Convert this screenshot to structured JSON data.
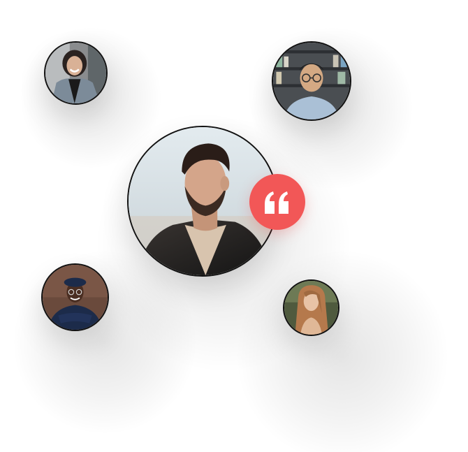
{
  "colors": {
    "accent": "#f25757",
    "border": "#111111",
    "background": "#ffffff"
  },
  "badge": {
    "icon": "quote-icon"
  },
  "avatars": [
    {
      "name": "featured-avatar",
      "description": "man with beard"
    },
    {
      "name": "avatar-woman-denim"
    },
    {
      "name": "avatar-man-glasses"
    },
    {
      "name": "avatar-man-beret"
    },
    {
      "name": "avatar-woman-long-hair"
    }
  ]
}
